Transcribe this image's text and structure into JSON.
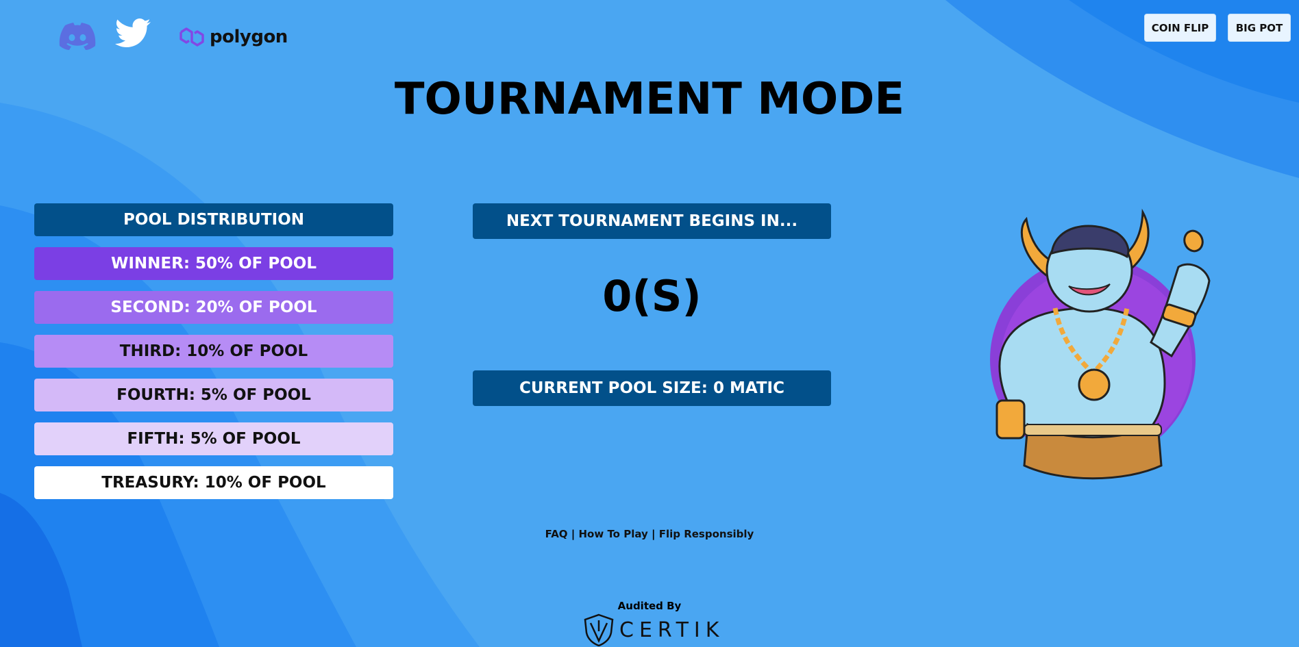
{
  "header": {
    "social": [
      {
        "name": "discord-icon"
      },
      {
        "name": "twitter-icon"
      }
    ],
    "brand": "polygon",
    "nav": [
      {
        "label": "COIN FLIP"
      },
      {
        "label": "BIG POT"
      }
    ]
  },
  "page_title": "TOURNAMENT MODE",
  "distribution": {
    "header": "POOL DISTRIBUTION",
    "rows": [
      {
        "label": "WINNER: 50% OF POOL",
        "color": "#7b3fe4"
      },
      {
        "label": "SECOND: 20% OF POOL",
        "color": "#9b6bee"
      },
      {
        "label": "THIRD: 10% OF POOL",
        "color": "#b68cf5"
      },
      {
        "label": "FOURTH: 5% OF POOL",
        "color": "#d4b9f8"
      },
      {
        "label": "FIFTH: 5% OF POOL",
        "color": "#e2d1fa"
      },
      {
        "label": "TREASURY: 10% OF POOL",
        "color": "#ffffff"
      }
    ]
  },
  "tournament": {
    "next_label": "NEXT TOURNAMENT BEGINS IN...",
    "countdown": "0(S)",
    "pool_size": "CURRENT POOL SIZE: 0 MATIC"
  },
  "footer": {
    "links": [
      "FAQ",
      "How To Play",
      "Flip Responsibly"
    ],
    "separator": " | ",
    "audited_by": "Audited By",
    "auditor": "CERTIK"
  },
  "colors": {
    "background": "#4aa6f2",
    "panel": "#02508a",
    "accent_purple": "#8247e5"
  }
}
